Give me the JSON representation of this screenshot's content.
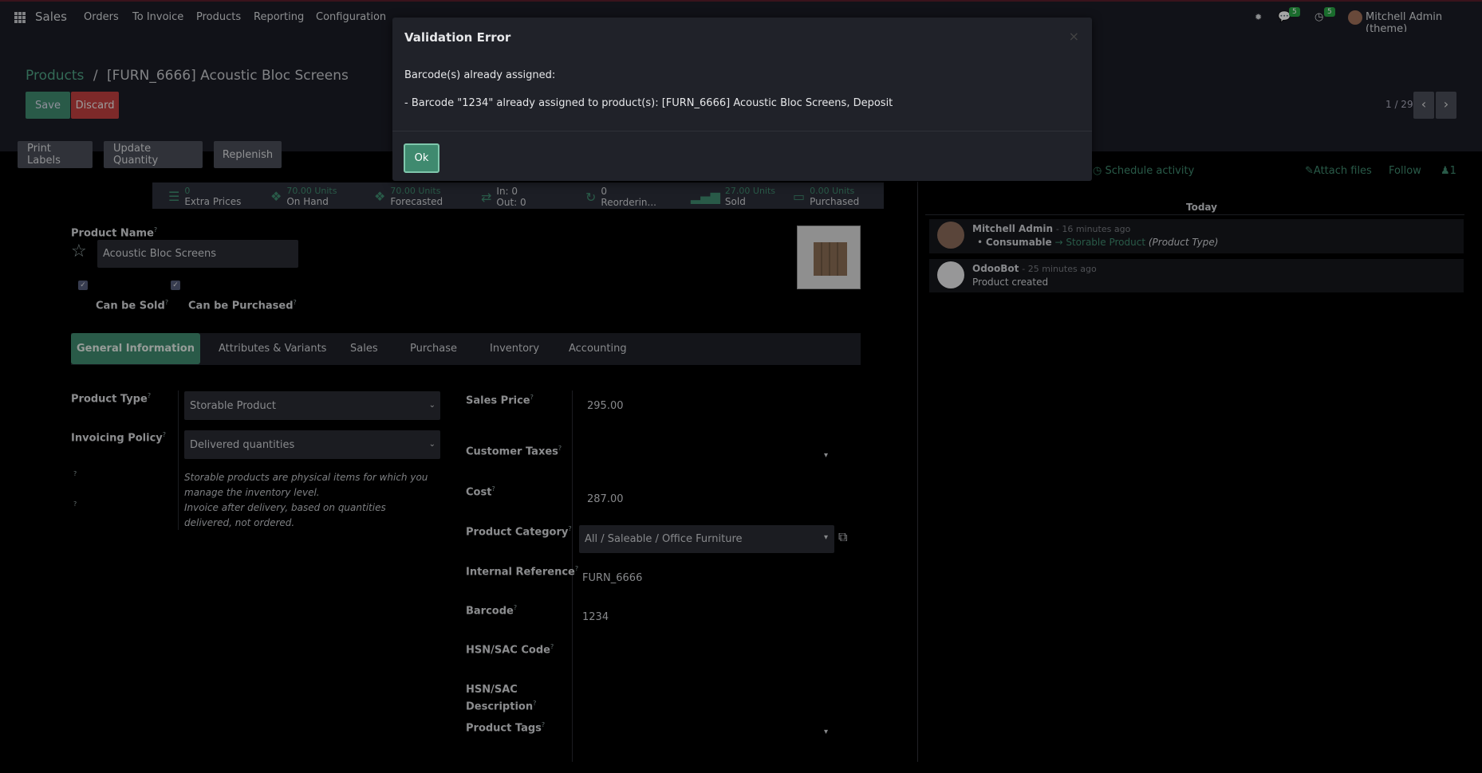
{
  "topbar": {
    "app_name": "Sales",
    "menu": [
      "Orders",
      "To Invoice",
      "Products",
      "Reporting",
      "Configuration"
    ],
    "messages_badge": "5",
    "activity_badge": "5",
    "user": "Mitchell Admin (theme)"
  },
  "breadcrumb": {
    "parent": "Products",
    "sep": "/",
    "current": "[FURN_6666] Acoustic Bloc Screens"
  },
  "buttons": {
    "save": "Save",
    "discard": "Discard",
    "print_labels": "Print Labels",
    "update_quantity": "Update Quantity",
    "replenish": "Replenish"
  },
  "pager": {
    "text": "1 / 29"
  },
  "stats": [
    {
      "value": "0",
      "label": "Extra Prices"
    },
    {
      "value": "70.00 Units",
      "label": "On Hand"
    },
    {
      "value": "70.00 Units",
      "label": "Forecasted"
    },
    {
      "value": "In: 0",
      "label": "Out: 0"
    },
    {
      "value": "0",
      "label": "Reorderin..."
    },
    {
      "value": "27.00 Units",
      "label": "Sold"
    },
    {
      "value": "0.00 Units",
      "label": "Purchased"
    }
  ],
  "product": {
    "name_label": "Product Name",
    "name": "Acoustic Bloc Screens",
    "can_be_sold": "Can be Sold",
    "can_be_purchased": "Can be Purchased",
    "help_mark": "?"
  },
  "tabs": [
    "General Information",
    "Attributes & Variants",
    "Sales",
    "Purchase",
    "Inventory",
    "Accounting"
  ],
  "left_fields": {
    "product_type_label": "Product Type",
    "product_type": "Storable Product",
    "invoicing_policy_label": "Invoicing Policy",
    "invoicing_policy": "Delivered quantities",
    "help1": "Storable products are physical items for which you manage the inventory level.",
    "help2": "Invoice after delivery, based on quantities delivered, not ordered."
  },
  "right_fields": {
    "sales_price_label": "Sales Price",
    "sales_price": "295.00",
    "customer_taxes_label": "Customer Taxes",
    "cost_label": "Cost",
    "cost": "287.00",
    "category_label": "Product Category",
    "category": "All / Saleable / Office Furniture",
    "internal_ref_label": "Internal Reference",
    "internal_ref": "FURN_6666",
    "barcode_label": "Barcode",
    "barcode": "1234",
    "hsn_code_label": "HSN/SAC Code",
    "hsn_desc_label_1": "HSN/SAC",
    "hsn_desc_label_2": "Description",
    "tags_label": "Product Tags"
  },
  "chatter": {
    "schedule": "Schedule activity",
    "attach": "Attach files",
    "follow": "Follow",
    "followers": "1",
    "today": "Today",
    "messages": [
      {
        "author": "Mitchell Admin",
        "time": "- 16 minutes ago",
        "change_from": "Consumable",
        "arrow": "→",
        "change_to": "Storable Product",
        "field": "(Product Type)"
      },
      {
        "author": "OdooBot",
        "time": "- 25 minutes ago",
        "body": "Product created"
      }
    ]
  },
  "modal": {
    "title": "Validation Error",
    "line1": "Barcode(s) already assigned:",
    "line2": "- Barcode \"1234\" already assigned to product(s): [FURN_6666] Acoustic Bloc Screens, Deposit",
    "ok": "Ok",
    "close": "×"
  },
  "colors": {
    "accent": "#3f8a6f",
    "danger": "#c0403f",
    "topbar": "#1b1d26"
  }
}
